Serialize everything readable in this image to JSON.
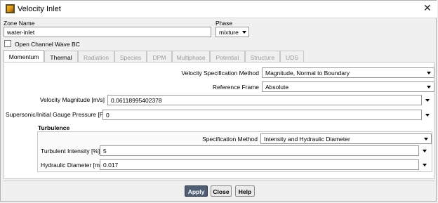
{
  "window": {
    "title": "Velocity Inlet",
    "close_glyph": "✕"
  },
  "zone": {
    "label": "Zone Name",
    "value": "water-inlet"
  },
  "phase": {
    "label": "Phase",
    "value": "mixture"
  },
  "open_channel": {
    "label": "Open Channel Wave BC",
    "checked": false
  },
  "tabs": [
    {
      "label": "Momentum",
      "state": "active"
    },
    {
      "label": "Thermal",
      "state": "enabled"
    },
    {
      "label": "Radiation",
      "state": "disabled"
    },
    {
      "label": "Species",
      "state": "disabled"
    },
    {
      "label": "DPM",
      "state": "disabled"
    },
    {
      "label": "Multiphase",
      "state": "disabled"
    },
    {
      "label": "Potential",
      "state": "disabled"
    },
    {
      "label": "Structure",
      "state": "disabled"
    },
    {
      "label": "UDS",
      "state": "disabled"
    }
  ],
  "momentum": {
    "velocity_spec_method": {
      "label": "Velocity Specification Method",
      "value": "Magnitude, Normal to Boundary"
    },
    "reference_frame": {
      "label": "Reference Frame",
      "value": "Absolute"
    },
    "velocity_magnitude": {
      "label": "Velocity Magnitude [m/s]",
      "value": "0.06118995402378"
    },
    "gauge_pressure": {
      "label": "Supersonic/Initial Gauge Pressure [Pa]",
      "value": "0"
    },
    "turbulence": {
      "heading": "Turbulence",
      "spec_method": {
        "label": "Specification Method",
        "value": "Intensity and Hydraulic Diameter"
      },
      "intensity": {
        "label": "Turbulent Intensity [%]",
        "value": "5"
      },
      "hydraulic_diameter": {
        "label": "Hydraulic Diameter [m]",
        "value": "0.017"
      }
    }
  },
  "buttons": {
    "apply": "Apply",
    "close": "Close",
    "help": "Help"
  }
}
